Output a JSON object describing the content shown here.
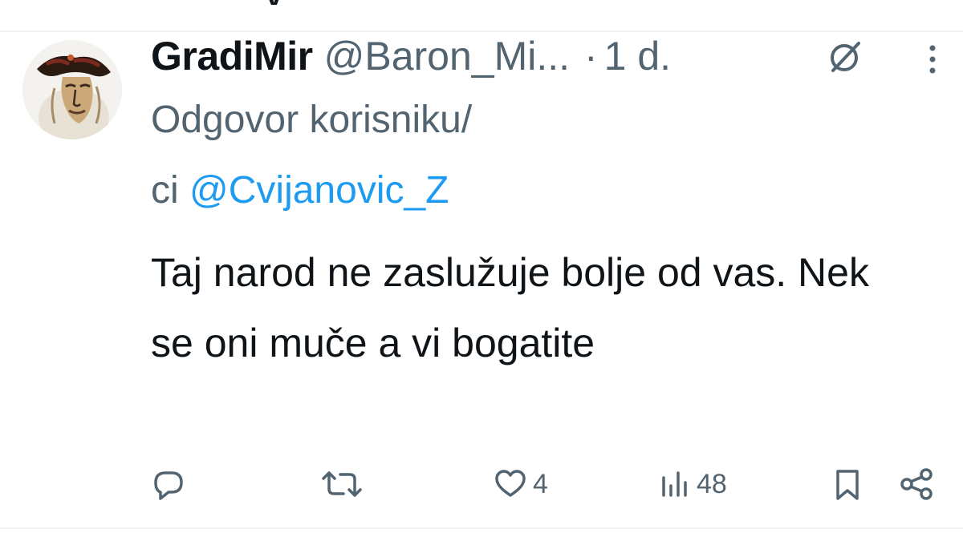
{
  "previous_tweet_tail": "y",
  "tweet": {
    "display_name": "GradiMir",
    "handle": "@Baron_Mi...",
    "separator": "·",
    "time": "1 d.",
    "reply_to_prefix_line1": "Odgovor korisniku/",
    "reply_to_prefix_line2": "ci",
    "reply_to_mention": "@Cvijanovic_Z",
    "text": "Taj narod ne zaslužuje bolje od vas. Nek se oni muče a vi bogatite"
  },
  "actions": {
    "reply": {
      "icon": "reply-icon"
    },
    "retweet": {
      "icon": "retweet-icon"
    },
    "like": {
      "icon": "heart-icon",
      "count": "4"
    },
    "views": {
      "icon": "views-icon",
      "count": "48"
    },
    "bookmark": {
      "icon": "bookmark-icon"
    },
    "share": {
      "icon": "share-icon"
    }
  },
  "colors": {
    "text_primary": "#0f1419",
    "text_secondary": "#536471",
    "link": "#1d9bf0",
    "divider": "#eff3f4"
  }
}
